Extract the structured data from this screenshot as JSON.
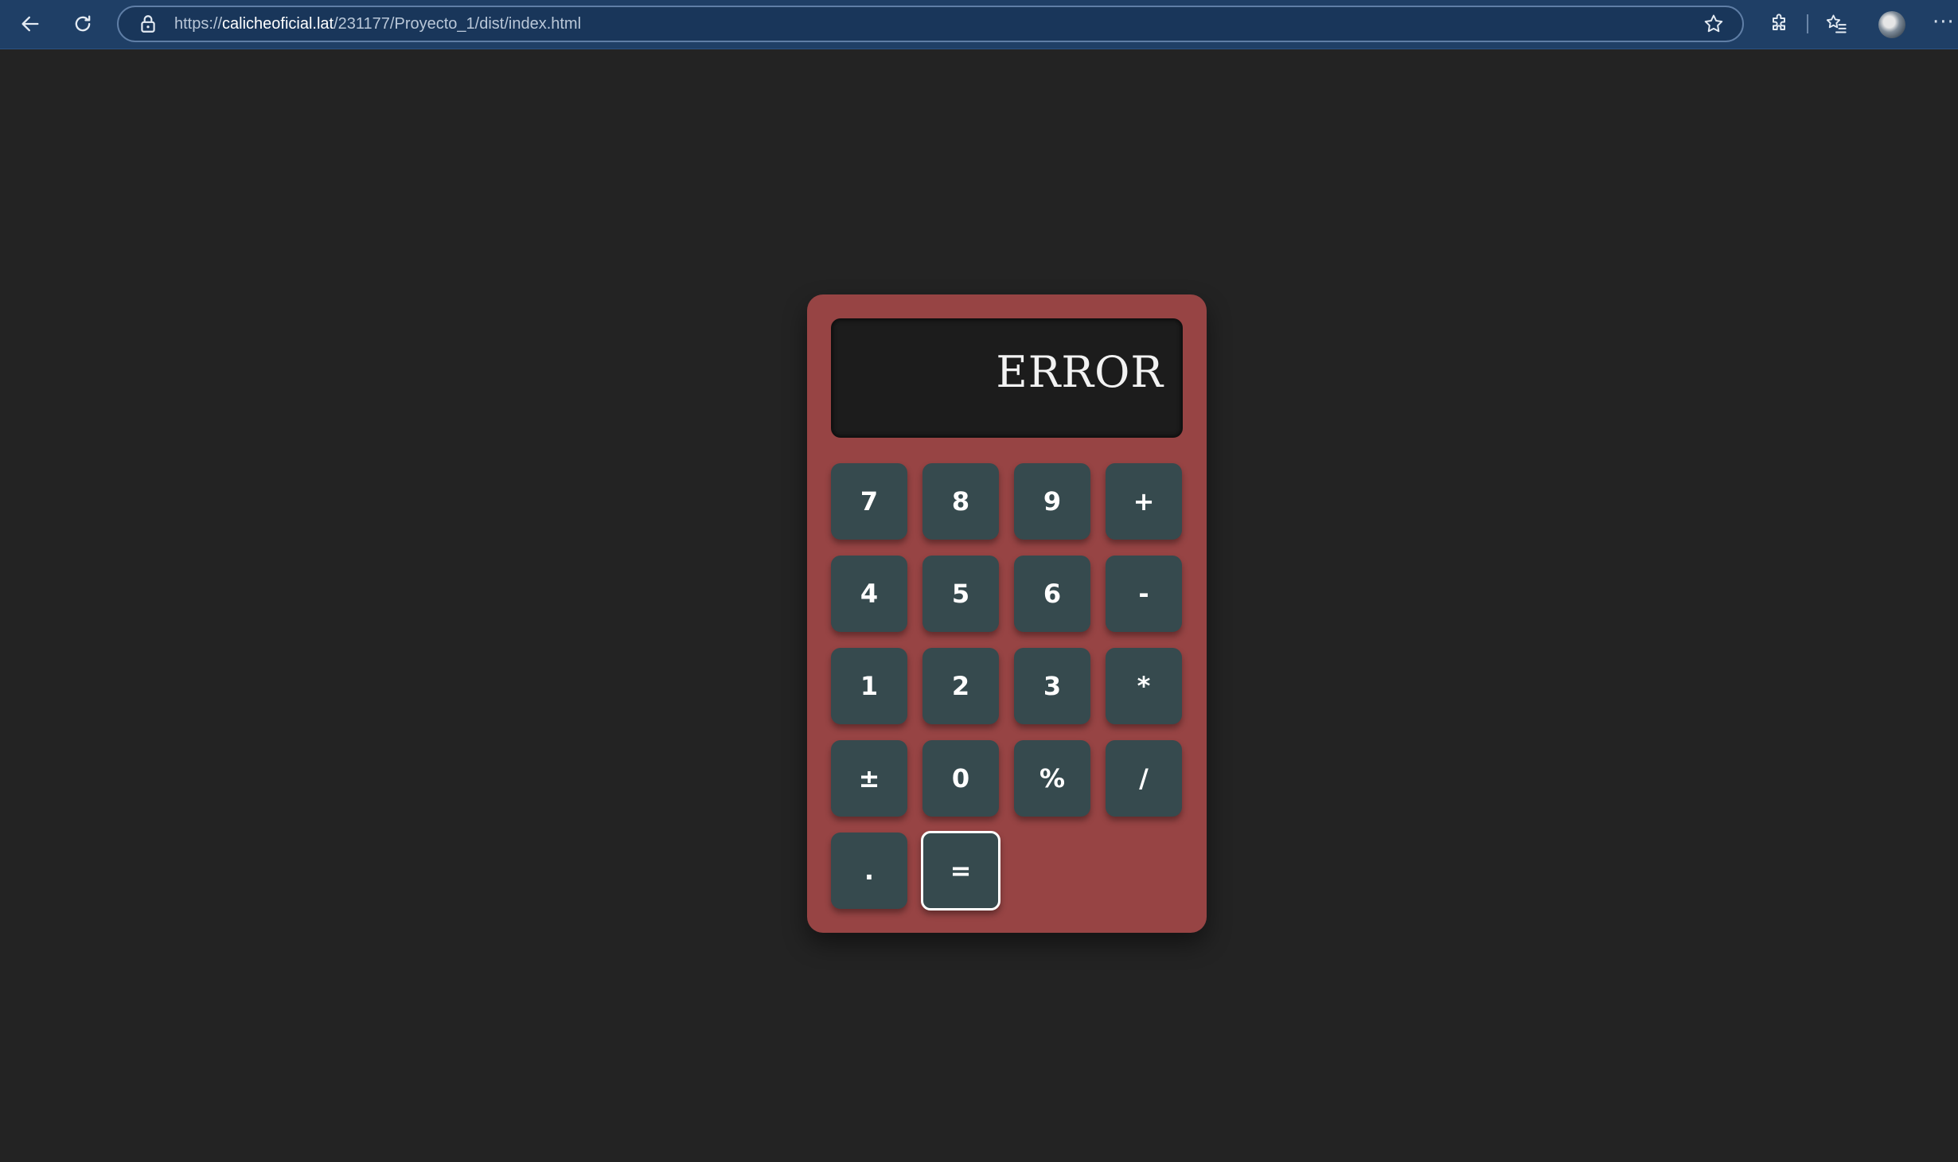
{
  "browser": {
    "url_scheme": "https://",
    "url_host": "calicheoficial.lat",
    "url_path": "/231177/Proyecto_1/dist/index.html"
  },
  "calculator": {
    "display_value": "ERROR",
    "colors": {
      "body": "#974444",
      "display": "#1c1c1c",
      "key": "#364a4e",
      "page_background": "#232323"
    },
    "keys": {
      "k7": "7",
      "k8": "8",
      "k9": "9",
      "plus": "+",
      "k4": "4",
      "k5": "5",
      "k6": "6",
      "minus": "-",
      "k1": "1",
      "k2": "2",
      "k3": "3",
      "multiply": "*",
      "plus_minus": "±",
      "k0": "0",
      "percent": "%",
      "divide": "/",
      "decimal": ".",
      "equals": "="
    }
  }
}
